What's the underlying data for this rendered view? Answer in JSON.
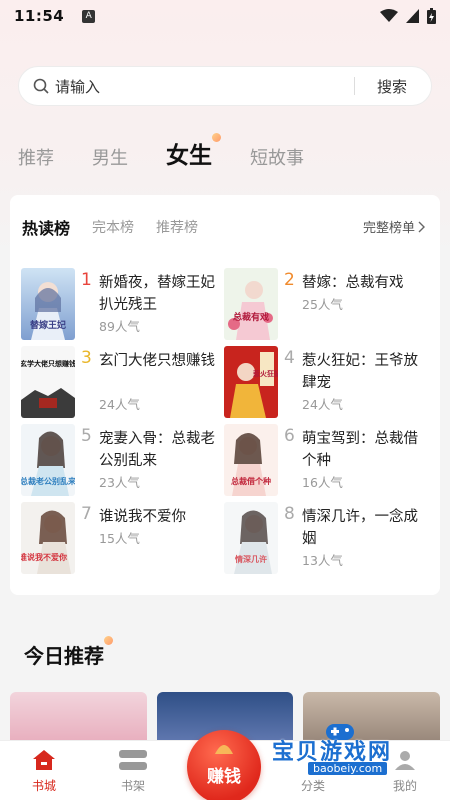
{
  "status": {
    "time": "11:54",
    "badge": "A"
  },
  "search": {
    "placeholder": "请输入",
    "button": "搜索"
  },
  "tabs": [
    {
      "label": "推荐"
    },
    {
      "label": "男生"
    },
    {
      "label": "女生",
      "active": true
    },
    {
      "label": "短故事"
    }
  ],
  "ranking": {
    "subtabs": [
      "热读榜",
      "完本榜",
      "推荐榜"
    ],
    "full_list": "完整榜单",
    "books": [
      {
        "rank": "1",
        "title": "新婚夜，替嫁王妃扒光残王",
        "popularity": "89人气",
        "cover_text": "替嫁王妃"
      },
      {
        "rank": "2",
        "title": "替嫁：总裁有戏",
        "popularity": "25人气",
        "cover_text": "总裁有戏"
      },
      {
        "rank": "3",
        "title": "玄门大佬只想赚钱",
        "popularity": "24人气",
        "cover_text": "玄学大佬只想赚钱"
      },
      {
        "rank": "4",
        "title": "惹火狂妃：王爷放肆宠",
        "popularity": "24人气",
        "cover_text": "惹火狂妃"
      },
      {
        "rank": "5",
        "title": "宠妻入骨：总裁老公别乱来",
        "popularity": "23人气",
        "cover_text": "总裁老公别乱来"
      },
      {
        "rank": "6",
        "title": "萌宝驾到：总裁借个种",
        "popularity": "16人气",
        "cover_text": "总裁借个种"
      },
      {
        "rank": "7",
        "title": "谁说我不爱你",
        "popularity": "15人气",
        "cover_text": "谁说我不爱你"
      },
      {
        "rank": "8",
        "title": "情深几许，一念成姻",
        "popularity": "13人气",
        "cover_text": "情深几许"
      }
    ]
  },
  "today": {
    "title": "今日推荐"
  },
  "nav": {
    "bookstore": "书城",
    "shelf": "书架",
    "earn": "赚钱",
    "category": "分类",
    "mine": "我的"
  },
  "watermark": {
    "text": "宝贝游戏网",
    "url": "baobeiy.com"
  },
  "colors": {
    "accent": "#d7281d",
    "rank1": "#e8443c",
    "rank2": "#f08a2c",
    "rank3": "#e9b62a"
  }
}
